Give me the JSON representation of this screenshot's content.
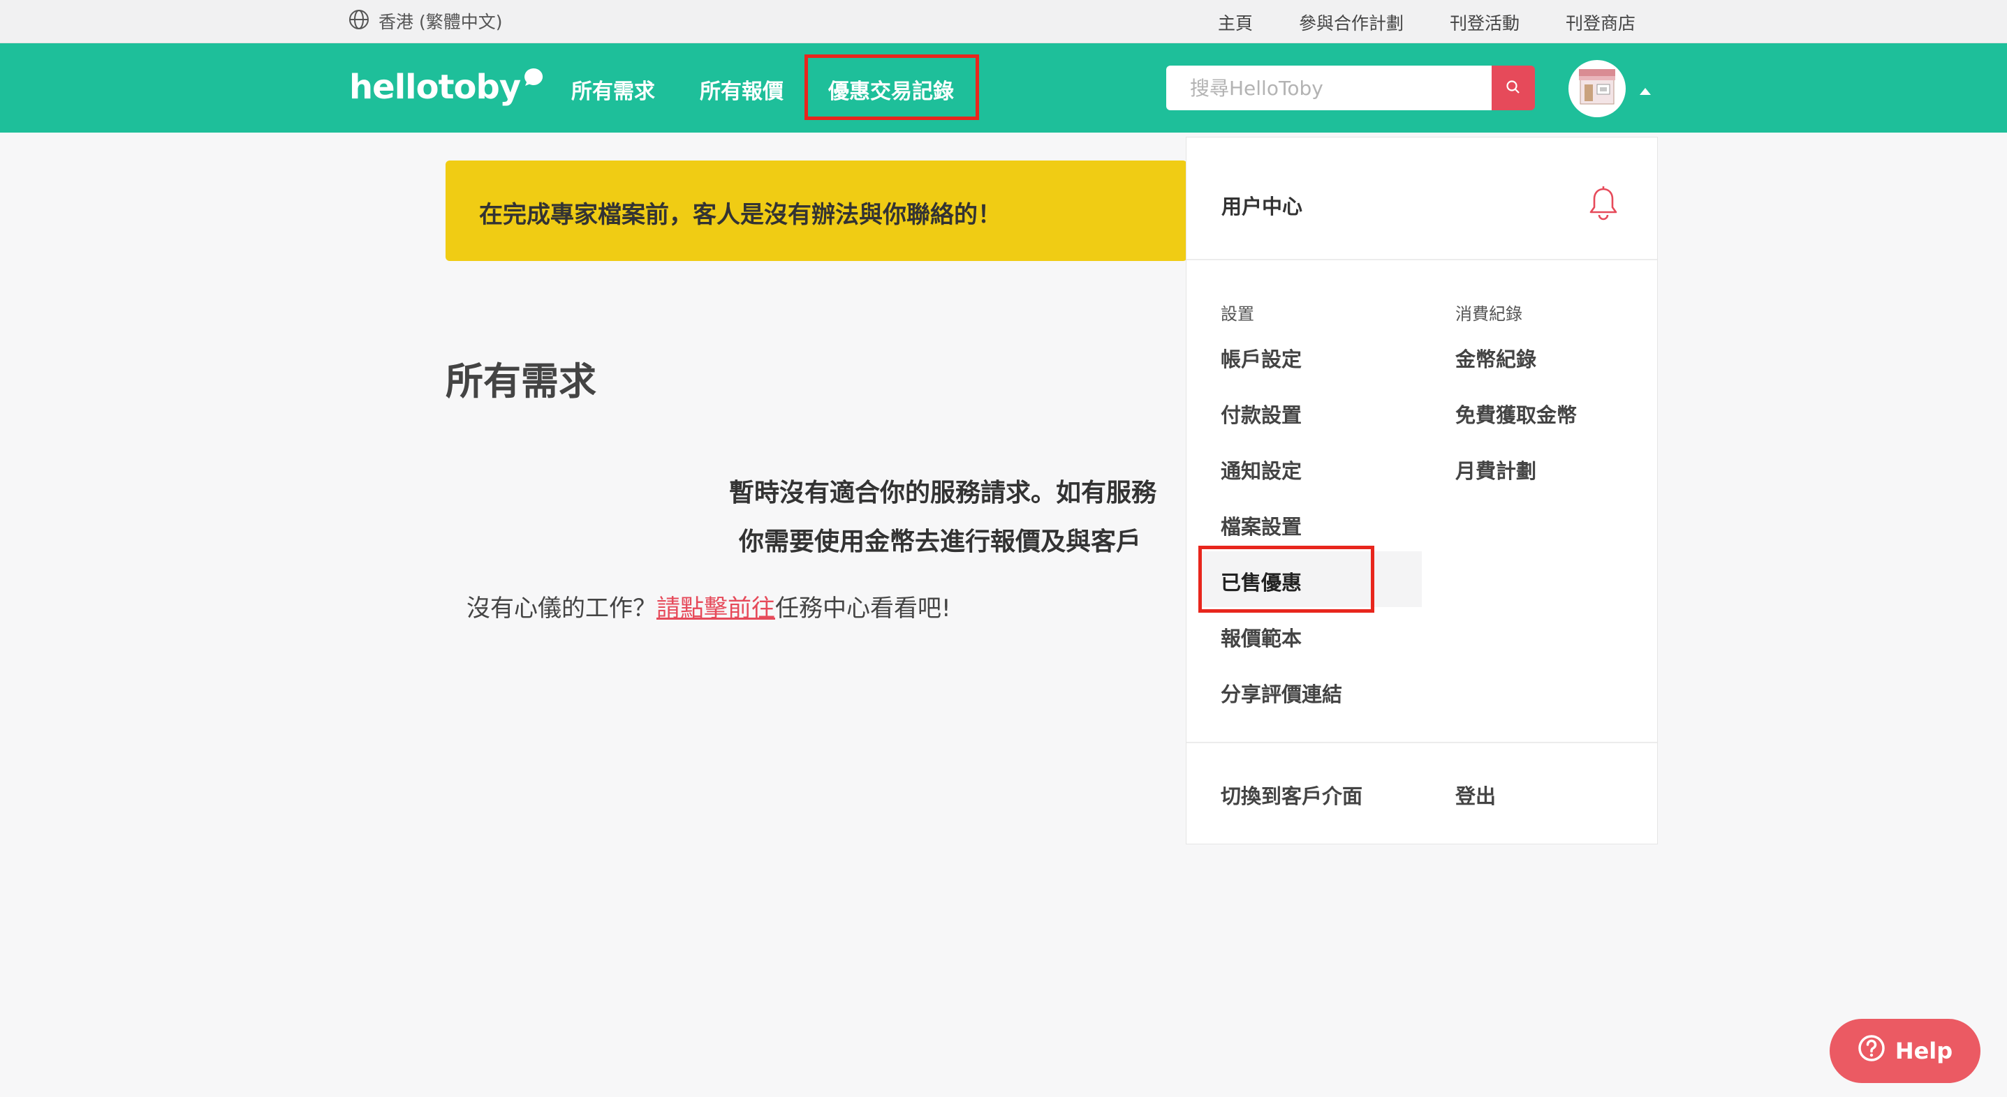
{
  "topbar": {
    "locale_icon": "globe-icon",
    "locale_label": "香港 (繁體中文)",
    "links": [
      "主頁",
      "參與合作計劃",
      "刊登活動",
      "刊登商店"
    ]
  },
  "navbar": {
    "logo_text": "hellotoby",
    "links": [
      "所有需求",
      "所有報價",
      "優惠交易記錄"
    ],
    "search_placeholder": "搜尋HelloToby",
    "search_icon": "search-icon",
    "accent_color": "#1ebf9a",
    "search_button_color": "#e64a5a",
    "highlight_color": "#e8261d"
  },
  "banner": {
    "text": "在完成專家檔案前，客人是沒有辦法與你聯絡的！",
    "color": "#f0cc14"
  },
  "main": {
    "title": "所有需求",
    "empty_line1": "暫時沒有適合你的服務請求。如有服務",
    "empty_line2": "你需要使用金幣去進行報價及與客戶",
    "hint_prefix": "沒有心儀的工作？",
    "hint_link": "請點擊前往",
    "hint_suffix": "任務中心看看吧!"
  },
  "dropdown": {
    "header_label": "用户中心",
    "bell_icon": "bell-icon",
    "settings_heading": "設置",
    "settings_items": [
      "帳戶設定",
      "付款設置",
      "通知設定",
      "檔案設置",
      "已售優惠",
      "報價範本",
      "分享評價連結"
    ],
    "spending_heading": "消費紀錄",
    "spending_items": [
      "金幣紀錄",
      "免費獲取金幣",
      "月費計劃"
    ],
    "footer_switch": "切換到客戶介面",
    "footer_logout": "登出"
  },
  "help": {
    "label": "Help",
    "icon": "question-circle-icon",
    "color": "#eb5a63"
  }
}
